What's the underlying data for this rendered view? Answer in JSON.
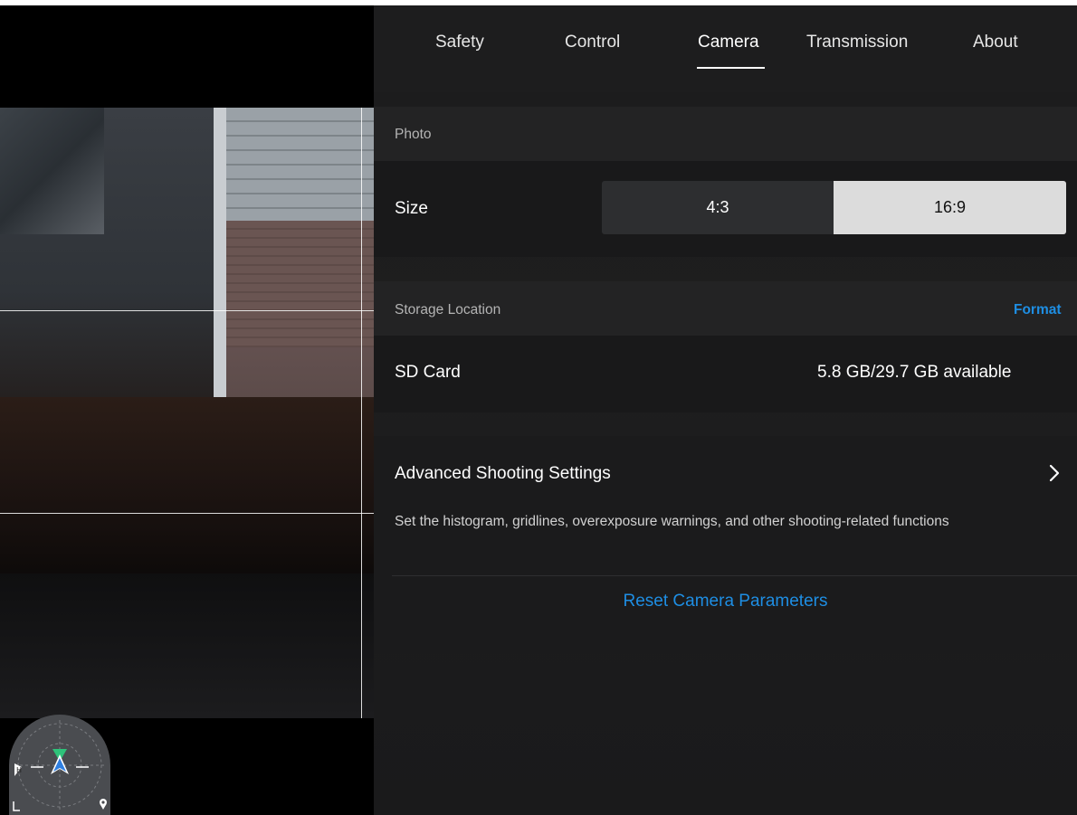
{
  "tabs": [
    {
      "label": "Safety"
    },
    {
      "label": "Control"
    },
    {
      "label": "Camera"
    },
    {
      "label": "Transmission"
    },
    {
      "label": "About"
    }
  ],
  "active_tab": "Camera",
  "photo": {
    "section_label": "Photo",
    "size_label": "Size",
    "size_options": [
      "4:3",
      "16:9"
    ],
    "size_selected": "16:9"
  },
  "storage": {
    "section_label": "Storage Location",
    "format_label": "Format",
    "device_label": "SD Card",
    "capacity": "5.8 GB/29.7 GB available"
  },
  "advanced": {
    "title": "Advanced Shooting Settings",
    "description": "Set the histogram, gridlines, overexposure warnings, and other shooting-related functions"
  },
  "reset_label": "Reset Camera Parameters",
  "colors": {
    "accent": "#1e8ee3",
    "panel_bg": "#1c1c1d",
    "selected_segment": "#dcdcdc"
  },
  "icons": {
    "advanced_chevron": "chevron-right-icon",
    "radar_aircraft": "aircraft-arrow-icon",
    "radar_home": "home-point-icon",
    "radar_location": "location-pin-icon"
  }
}
